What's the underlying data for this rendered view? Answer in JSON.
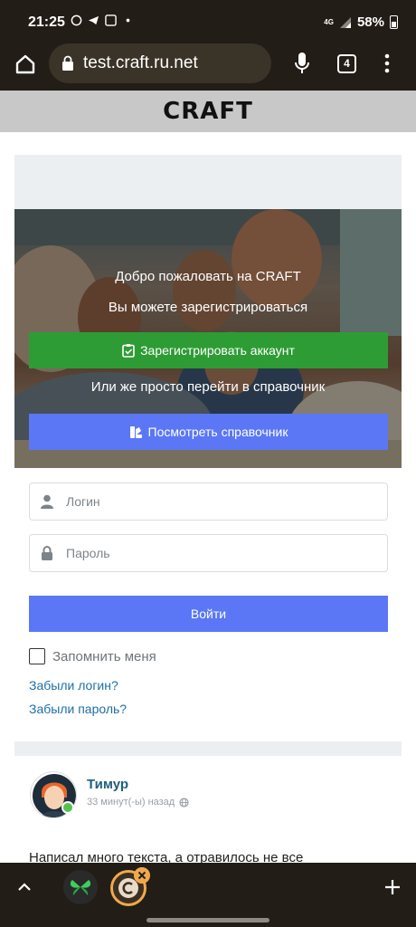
{
  "status_bar": {
    "time": "21:25",
    "network": "4G",
    "battery": "58%"
  },
  "browser": {
    "url": "test.craft.ru.net",
    "tab_count": "4"
  },
  "site": {
    "logo": "CRAFT"
  },
  "hero": {
    "title": "Добро пожаловать на CRAFT",
    "subtitle": "Вы можете зарегистрироваться",
    "register_button": "Зарегистрировать аккаунт",
    "or_text": "Или же просто перейти в справочник",
    "catalog_button": "Посмотреть справочник"
  },
  "login_form": {
    "login_placeholder": "Логин",
    "password_placeholder": "Пароль",
    "submit": "Войти",
    "remember_me": "Запомнить меня",
    "remember_checked": false,
    "forgot_login": "Забыли логин?",
    "forgot_password": "Забыли пароль?"
  },
  "post": {
    "author": "Тимур",
    "time": "33 минут(-ы) назад",
    "text": "Написал много текста, а отравилось не все"
  },
  "colors": {
    "register_green": "#2e9c35",
    "primary_blue": "#5b77f5",
    "link_blue": "#1d6fa5",
    "chrome_dark": "#221d16"
  }
}
